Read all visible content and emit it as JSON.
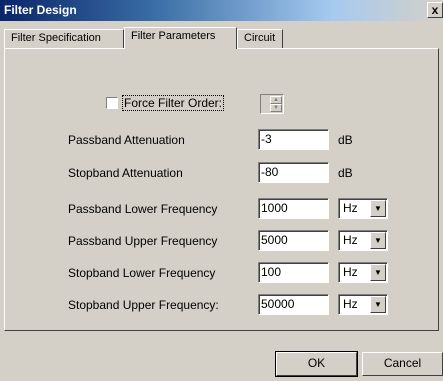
{
  "window": {
    "title": "Filter Design",
    "close_glyph": "x"
  },
  "tabs": [
    {
      "label": "Filter Specification"
    },
    {
      "label": "Filter Parameters",
      "active": true
    },
    {
      "label": "Circuit"
    }
  ],
  "force_filter_order": {
    "label": "Force Filter Order:",
    "checked": false,
    "value": ""
  },
  "params": [
    {
      "label": "Passband Attenuation",
      "value": "-3",
      "unit": "dB"
    },
    {
      "label": "Stopband Attenuation",
      "value": "-80",
      "unit": "dB"
    },
    {
      "label": "Passband Lower Frequency",
      "value": "1000",
      "unit": "Hz"
    },
    {
      "label": "Passband Upper Frequency",
      "value": "5000",
      "unit": "Hz"
    },
    {
      "label": "Stopband Lower Frequency",
      "value": "100",
      "unit": "Hz"
    },
    {
      "label": "Stopband Upper Frequency:",
      "value": "50000",
      "unit": "Hz"
    }
  ],
  "buttons": {
    "ok": "OK",
    "cancel": "Cancel"
  }
}
